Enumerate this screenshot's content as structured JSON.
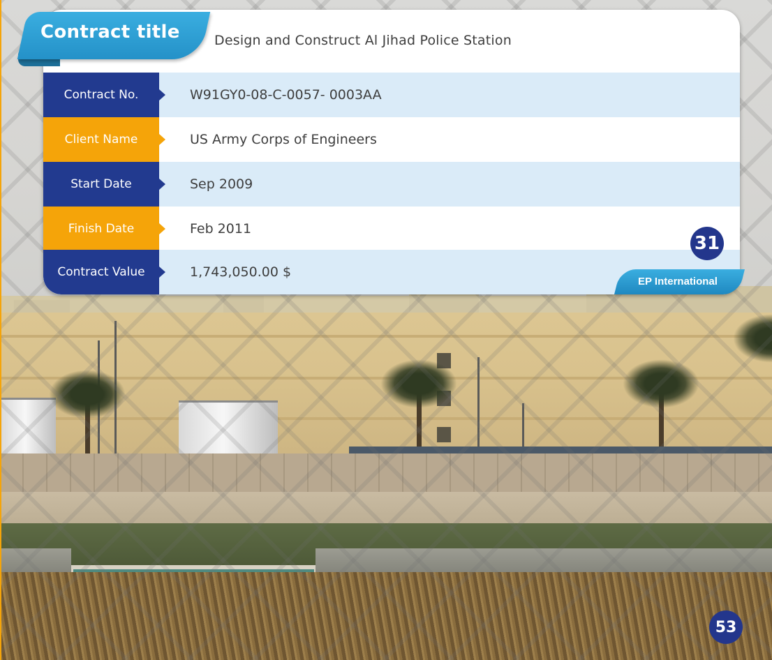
{
  "contract_title": {
    "label": "Contract title",
    "value": "Design and Construct Al Jihad Police Station"
  },
  "rows": [
    {
      "label": "Contract No.",
      "value": "W91GY0-08-C-0057- 0003AA",
      "color": "navy"
    },
    {
      "label": "Client Name",
      "value": "US Army Corps of Engineers",
      "color": "orange"
    },
    {
      "label": "Start Date",
      "value": "Sep 2009",
      "color": "navy"
    },
    {
      "label": "Finish Date",
      "value": "Feb 2011",
      "color": "orange"
    },
    {
      "label": "Contract Value",
      "value": "1,743,050.00 $",
      "color": "navy"
    }
  ],
  "project_number": "31",
  "company_tag": "EP International",
  "page_number": "53",
  "colors": {
    "navy": "#223a8f",
    "orange": "#f5a409",
    "ribbon_blue": "#2a9fd6",
    "row_tint": "#daebf8"
  }
}
